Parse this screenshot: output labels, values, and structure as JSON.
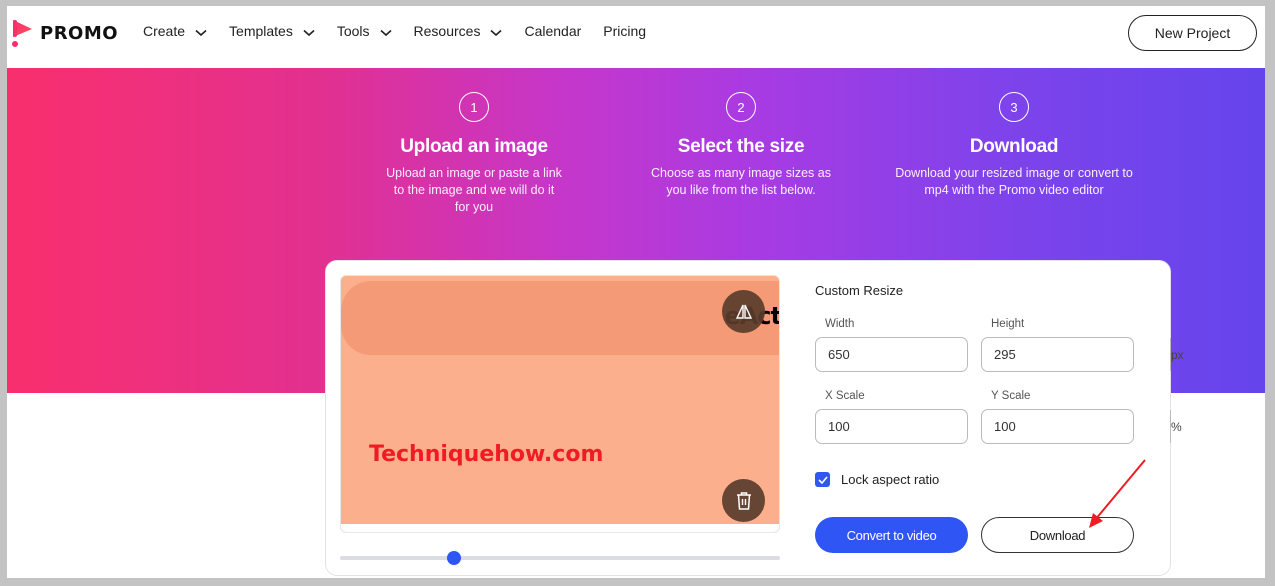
{
  "brand": {
    "name": "PROMO",
    "gradient_start": "#f92f6d",
    "gradient_end": "#6544ec",
    "accent_blue": "#2f55f4"
  },
  "nav": {
    "items": [
      {
        "label": "Create",
        "has_dropdown": true
      },
      {
        "label": "Templates",
        "has_dropdown": true
      },
      {
        "label": "Tools",
        "has_dropdown": true
      },
      {
        "label": "Resources",
        "has_dropdown": true
      },
      {
        "label": "Calendar",
        "has_dropdown": false
      },
      {
        "label": "Pricing",
        "has_dropdown": false
      }
    ],
    "new_project_label": "New Project"
  },
  "steps": [
    {
      "number": "1",
      "title": "Upload an image",
      "description": "Upload an image or paste a link to the image and we will do it for you"
    },
    {
      "number": "2",
      "title": "Select the size",
      "description": "Choose as many image sizes as you like from the list below."
    },
    {
      "number": "3",
      "title": "Download",
      "description": "Download your resized image or convert to mp4 with the Promo video editor"
    }
  ],
  "preview": {
    "brand_fragment": "eAct",
    "watermark": "Techniquehow.com",
    "flip_icon": "flip-horizontal-icon",
    "delete_icon": "trash-icon",
    "zoom_slider_fraction": 0.25
  },
  "resize": {
    "title": "Custom Resize",
    "width": {
      "label": "Width",
      "value": "650",
      "unit": "px"
    },
    "height": {
      "label": "Height",
      "value": "295",
      "unit": "px"
    },
    "x_scale": {
      "label": "X Scale",
      "value": "100",
      "unit": "%"
    },
    "y_scale": {
      "label": "Y Scale",
      "value": "100",
      "unit": "%"
    },
    "lock_aspect_ratio": {
      "label": "Lock aspect ratio",
      "checked": true
    },
    "convert_label": "Convert to video",
    "download_label": "Download"
  },
  "annotation": {
    "arrow_color": "#ee1c25",
    "points_to": "download-button"
  }
}
